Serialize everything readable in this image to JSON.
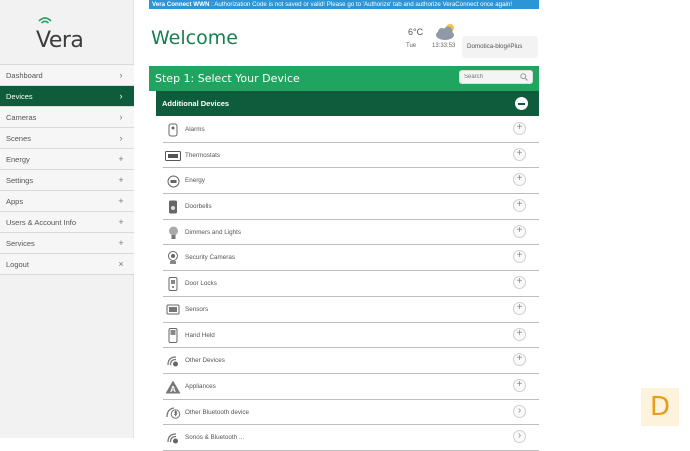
{
  "logo": {
    "text": "Vera"
  },
  "nav": [
    {
      "label": "Dashboard",
      "indicator": "›",
      "active": false
    },
    {
      "label": "Devices",
      "indicator": "›",
      "active": true
    },
    {
      "label": "Cameras",
      "indicator": "›",
      "active": false
    },
    {
      "label": "Scenes",
      "indicator": "›",
      "active": false
    },
    {
      "label": "Energy",
      "indicator": "+",
      "active": false
    },
    {
      "label": "Settings",
      "indicator": "+",
      "active": false
    },
    {
      "label": "Apps",
      "indicator": "+",
      "active": false
    },
    {
      "label": "Users & Account Info",
      "indicator": "+",
      "active": false
    },
    {
      "label": "Services",
      "indicator": "+",
      "active": false
    },
    {
      "label": "Logout",
      "indicator": "×",
      "active": false
    }
  ],
  "banner": {
    "prefix": "Vera Connect WWN",
    "text": " : Authorization Code is not saved or valid! Please go to 'Authorize' tab and authorize VeraConnect once again!"
  },
  "header": {
    "title": "Welcome",
    "temperature": "6°C",
    "day": "Tue",
    "time": "13:33:53",
    "user": "Domotica-blog#Plus"
  },
  "step": {
    "title": "Step 1: Select Your Device",
    "search_placeholder": "Search"
  },
  "category": {
    "title": "Additional Devices"
  },
  "devices": [
    {
      "label": "Alarms",
      "icon": "alarm-icon",
      "action": "+"
    },
    {
      "label": "Thermostats",
      "icon": "thermostat-icon",
      "action": "+"
    },
    {
      "label": "Energy",
      "icon": "energy-icon",
      "action": "+"
    },
    {
      "label": "Doorbells",
      "icon": "doorbell-icon",
      "action": "+"
    },
    {
      "label": "Dimmers and Lights",
      "icon": "bulb-icon",
      "action": "+"
    },
    {
      "label": "Security Cameras",
      "icon": "camera-icon",
      "action": "+"
    },
    {
      "label": "Door Locks",
      "icon": "lock-icon",
      "action": "+"
    },
    {
      "label": "Sensors",
      "icon": "sensor-icon",
      "action": "+"
    },
    {
      "label": "Hand Held",
      "icon": "remote-icon",
      "action": "+"
    },
    {
      "label": "Other Devices",
      "icon": "wireless-icon",
      "action": "+"
    },
    {
      "label": "Appliances",
      "icon": "appliance-icon",
      "action": "+"
    },
    {
      "label": "Other Bluetooth device",
      "icon": "bluetooth-icon",
      "action": "›"
    },
    {
      "label": "Sonos & Bluetooth ...",
      "icon": "wireless-icon",
      "action": "›"
    }
  ],
  "badge": {
    "letter": "D"
  },
  "colors": {
    "accent": "#1fa560",
    "dark_green": "#0f5c3c",
    "banner": "#2b95d6"
  }
}
